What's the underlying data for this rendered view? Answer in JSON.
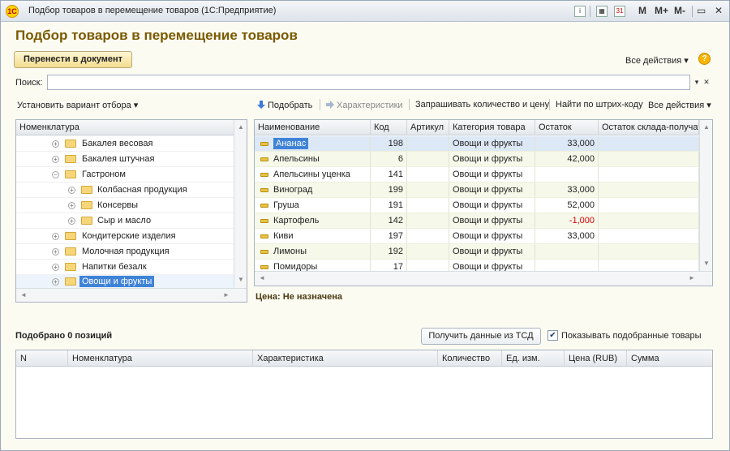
{
  "window": {
    "title": "Подбор товаров в перемещение товаров  (1С:Предприятие)",
    "logo": "1С",
    "toolbar": [
      "M",
      "M+",
      "M-"
    ]
  },
  "form": {
    "heading": "Подбор товаров в перемещение товаров",
    "transfer_button": "Перенести в документ",
    "all_actions": "Все действия ▾",
    "help": "?",
    "search_label": "Поиск:",
    "search_value": "",
    "filter_variant": "Установить вариант отбора ▾"
  },
  "grid_toolbar": {
    "select": "Подобрать",
    "characteristics": "Характеристики",
    "ask_qty": "Запрашивать количество и цену",
    "barcode": "Найти по штрих-коду",
    "all_actions": "Все действия ▾"
  },
  "tree": {
    "header": "Номенклатура",
    "items": [
      {
        "label": "Бакалея весовая",
        "expander": "+"
      },
      {
        "label": "Бакалея штучная",
        "expander": "+"
      },
      {
        "label": "Гастроном",
        "expander": "−"
      },
      {
        "label": "Колбасная продукция",
        "expander": "+"
      },
      {
        "label": "Консервы",
        "expander": "+"
      },
      {
        "label": "Сыр и масло",
        "expander": "+"
      },
      {
        "label": "Кондитерские изделия",
        "expander": "+"
      },
      {
        "label": "Молочная продукция",
        "expander": "+"
      },
      {
        "label": "Напитки безалк",
        "expander": "+"
      },
      {
        "label": "Овощи и фрукты",
        "expander": "+"
      }
    ]
  },
  "grid": {
    "columns": [
      "Наименование",
      "Код",
      "Артикул",
      "Категория товара",
      "Остаток",
      "Остаток склада-получат"
    ],
    "rows": [
      {
        "name": "Ананас",
        "code": "198",
        "article": "",
        "category": "Овощи и фрукты",
        "stock": "33,000",
        "stock_receiver": ""
      },
      {
        "name": "Апельсины",
        "code": "6",
        "article": "",
        "category": "Овощи и фрукты",
        "stock": "42,000",
        "stock_receiver": ""
      },
      {
        "name": "Апельсины уценка",
        "code": "141",
        "article": "",
        "category": "Овощи и фрукты",
        "stock": "",
        "stock_receiver": ""
      },
      {
        "name": "Виноград",
        "code": "199",
        "article": "",
        "category": "Овощи и фрукты",
        "stock": "33,000",
        "stock_receiver": ""
      },
      {
        "name": "Груша",
        "code": "191",
        "article": "",
        "category": "Овощи и фрукты",
        "stock": "52,000",
        "stock_receiver": ""
      },
      {
        "name": "Картофель",
        "code": "142",
        "article": "",
        "category": "Овощи и фрукты",
        "stock": "-1,000",
        "stock_receiver": ""
      },
      {
        "name": "Киви",
        "code": "197",
        "article": "",
        "category": "Овощи и фрукты",
        "stock": "33,000",
        "stock_receiver": ""
      },
      {
        "name": "Лимоны",
        "code": "192",
        "article": "",
        "category": "Овощи и фрукты",
        "stock": "",
        "stock_receiver": ""
      },
      {
        "name": "Помидоры",
        "code": "17",
        "article": "",
        "category": "Овощи и фрукты",
        "stock": "",
        "stock_receiver": ""
      }
    ]
  },
  "price_status": "Цена: Не назначена",
  "selection": {
    "count_text": "Подобрано 0 позиций",
    "tsd_button": "Получить данные из ТСД",
    "show_selected_label": "Показывать подобранные товары",
    "show_selected_checked": true,
    "columns": [
      "N",
      "Номенклатура",
      "Характеристика",
      "Количество",
      "Ед. изм.",
      "Цена (RUB)",
      "Сумма"
    ]
  },
  "colors": {
    "accent": "#7a5a00",
    "selection": "#3f83d8",
    "negative": "#e00000"
  }
}
